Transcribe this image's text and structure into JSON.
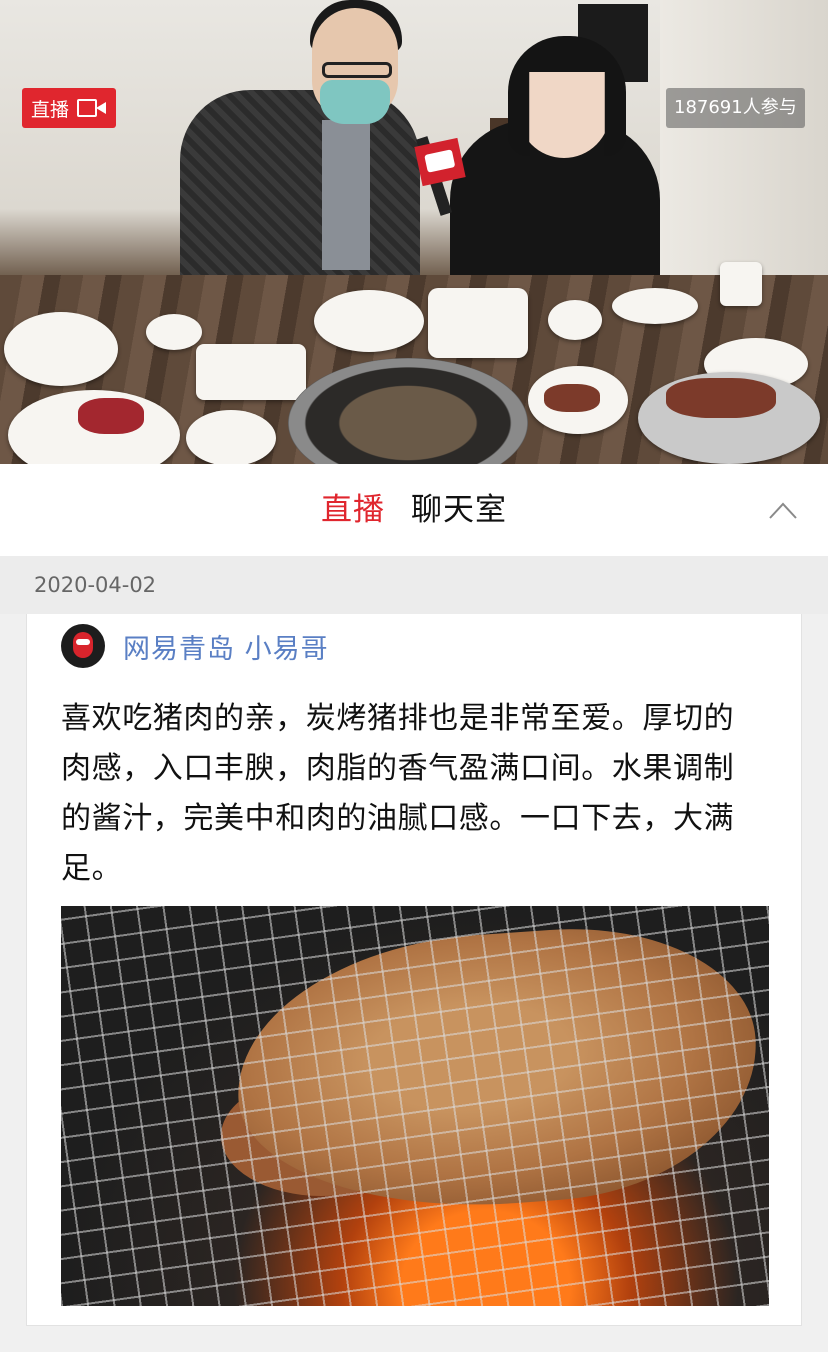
{
  "live": {
    "badge_label": "直播",
    "participants": "187691人参与"
  },
  "tabs": [
    {
      "label": "直播",
      "active": true
    },
    {
      "label": "聊天室",
      "active": false
    }
  ],
  "date": "2020-04-02",
  "post": {
    "author": "网易青岛 小易哥",
    "text": "喜欢吃猪肉的亲，炭烤猪排也是非常至爱。厚切的肉感，入口丰腴，肉脂的香气盈满口间。水果调制的酱汁，完美中和肉的油腻口感。一口下去，大满足。"
  },
  "icons": {
    "live": "video-camera-icon",
    "collapse": "chevron-up-icon"
  },
  "colors": {
    "accent": "#e0262e",
    "author_link": "#5a7fc4"
  }
}
